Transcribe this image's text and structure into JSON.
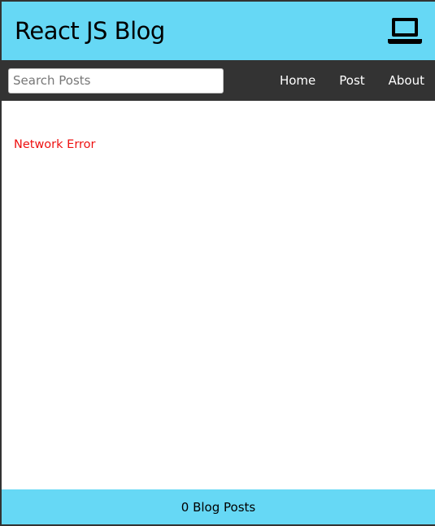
{
  "header": {
    "title": "React JS Blog",
    "icon": "laptop-icon",
    "background_color": "#66d8f5"
  },
  "nav": {
    "background_color": "#333333",
    "search": {
      "placeholder": "Search Posts",
      "value": ""
    },
    "links": [
      {
        "label": "Home"
      },
      {
        "label": "Post"
      },
      {
        "label": "About"
      }
    ]
  },
  "main": {
    "error_message": "Network Error",
    "error_color": "#ee1111"
  },
  "footer": {
    "text": "0 Blog Posts",
    "background_color": "#66d8f5"
  }
}
